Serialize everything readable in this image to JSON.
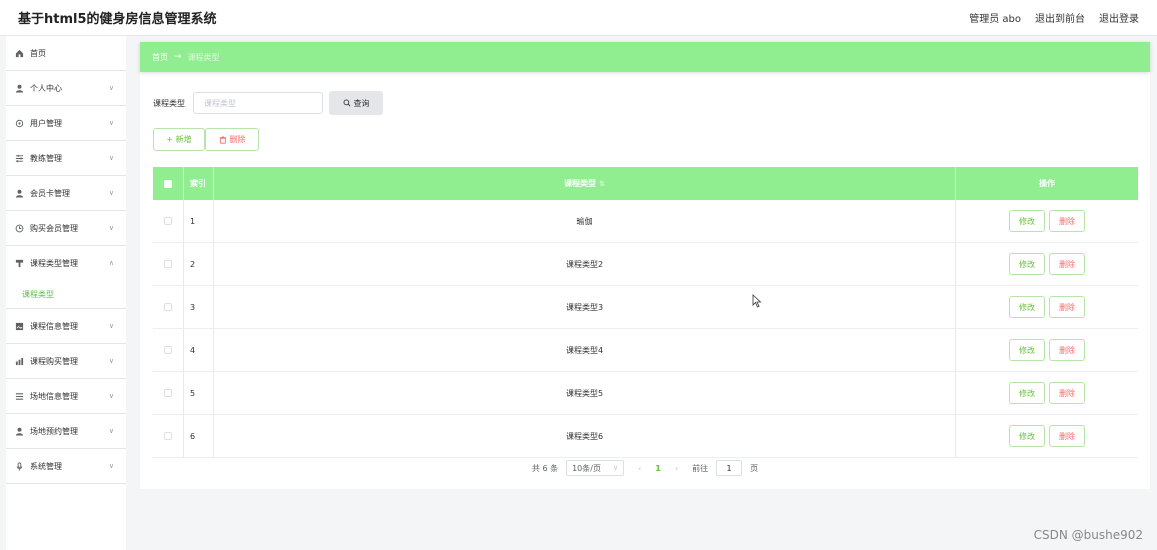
{
  "header": {
    "app_title": "基于html5的健身房信息管理系统",
    "admin": "管理员 abo",
    "to_front": "退出到前台",
    "logout": "退出登录"
  },
  "sidebar": {
    "items": [
      {
        "label": "首页",
        "icon": "home-icon"
      },
      {
        "label": "个人中心",
        "icon": "user-icon"
      },
      {
        "label": "用户管理",
        "icon": "gear-icon"
      },
      {
        "label": "教练管理",
        "icon": "sliders-icon"
      },
      {
        "label": "会员卡管理",
        "icon": "user-icon"
      },
      {
        "label": "购买会员管理",
        "icon": "clock-icon"
      },
      {
        "label": "课程类型管理",
        "icon": "shield-icon"
      },
      {
        "label": "课程信息管理",
        "icon": "image-icon"
      },
      {
        "label": "课程购买管理",
        "icon": "chart-icon"
      },
      {
        "label": "场地信息管理",
        "icon": "list-icon"
      },
      {
        "label": "场地预约管理",
        "icon": "user-icon"
      },
      {
        "label": "系统管理",
        "icon": "mic-icon"
      }
    ],
    "sub_item": "课程类型"
  },
  "breadcrumb": {
    "home": "首页",
    "arrow": "→",
    "current": "课程类型"
  },
  "search": {
    "label": "课程类型",
    "placeholder": "课程类型",
    "button": "查询"
  },
  "actions": {
    "add": "+ 新增",
    "delete": "删除"
  },
  "table": {
    "headers": {
      "index": "索引",
      "type": "课程类型",
      "ops": "操作"
    },
    "rows": [
      {
        "index": "1",
        "type": "瑜伽"
      },
      {
        "index": "2",
        "type": "课程类型2"
      },
      {
        "index": "3",
        "type": "课程类型3"
      },
      {
        "index": "4",
        "type": "课程类型4"
      },
      {
        "index": "5",
        "type": "课程类型5"
      },
      {
        "index": "6",
        "type": "课程类型6"
      }
    ],
    "edit_label": "修改",
    "delete_label": "删除"
  },
  "pagination": {
    "total": "共 6 条",
    "page_size": "10条/页",
    "prev": "‹",
    "current_page": "1",
    "next": "›",
    "goto_label": "前往",
    "goto_value": "1",
    "page_suffix": "页"
  },
  "watermark": "CSDN @bushe902",
  "colors": {
    "accent": "#90ee90",
    "success": "#67c23a",
    "danger": "#f56c6c"
  }
}
